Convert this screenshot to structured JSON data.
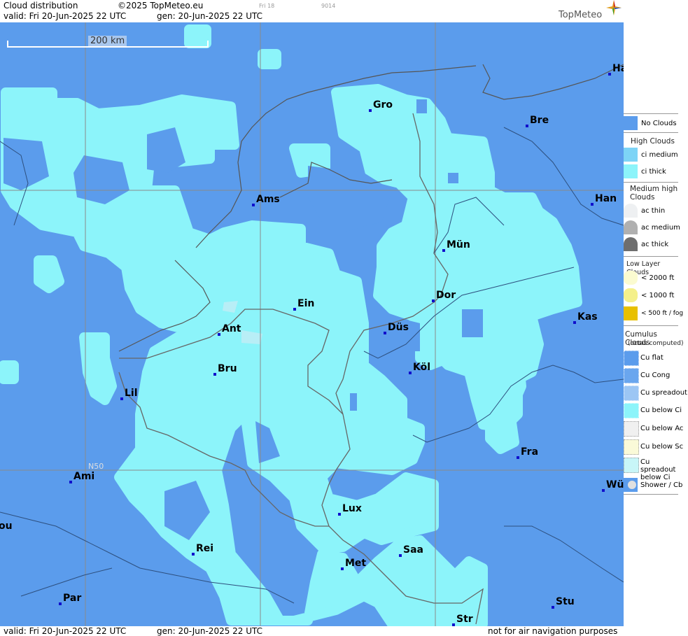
{
  "header": {
    "title": "Cloud distribution",
    "copyright": "©2025 TopMeteo.eu",
    "small1": "Fri 18",
    "small2": "9014",
    "valid": "valid:  Fri  20-Jun-2025  22 UTC",
    "gen": "gen: 20-Jun-2025 22 UTC",
    "brand": "TopMeteo"
  },
  "footer": {
    "valid": "valid:  Fri  20-Jun-2025  22 UTC",
    "gen": "gen: 20-Jun-2025 22 UTC",
    "disclaimer": "not for air navigation purposes"
  },
  "map": {
    "scale_label": "200 km",
    "lat_label": "N50",
    "colors": {
      "no_clouds": "#5b9cec",
      "ci_thick": "#8cf4fa",
      "ci_medium": "#7dd4f6",
      "grid": "#8a8a8a",
      "city_dot": "#1010cc"
    },
    "cities": [
      {
        "name": "Ha"
      },
      {
        "name": "Gro"
      },
      {
        "name": "Bre"
      },
      {
        "name": "Ams"
      },
      {
        "name": "Han"
      },
      {
        "name": "Mün"
      },
      {
        "name": "Dor"
      },
      {
        "name": "Ein"
      },
      {
        "name": "Ant"
      },
      {
        "name": "Düs"
      },
      {
        "name": "Kas"
      },
      {
        "name": "Bru"
      },
      {
        "name": "Köl"
      },
      {
        "name": "Lil"
      },
      {
        "name": "Fra"
      },
      {
        "name": "Ami"
      },
      {
        "name": "Wü"
      },
      {
        "name": "Lux"
      },
      {
        "name": "ou"
      },
      {
        "name": "Rei"
      },
      {
        "name": "Saa"
      },
      {
        "name": "Met"
      },
      {
        "name": "Par"
      },
      {
        "name": "Stu"
      },
      {
        "name": "Str"
      }
    ]
  },
  "legend": {
    "no_clouds": "No Clouds",
    "high_clouds": "High Clouds",
    "ci_medium": "ci medium",
    "ci_thick": "ci thick",
    "medium_high": "Medium high Clouds",
    "ac_thin": "ac thin",
    "ac_medium": "ac medium",
    "ac_thick": "ac thick",
    "low_layer": "Low Layer Clouds",
    "lt2000": "< 2000 ft",
    "lt1000": "< 1000 ft",
    "lt500": "< 500 ft / fog",
    "cumulus": "Cumulus Clouds",
    "octas": "(octas computed)",
    "cu_flat": "Cu flat",
    "cu_cong": "Cu Cong",
    "cu_spreadout": "Cu spreadout",
    "cu_below_ci": "Cu below Ci",
    "cu_below_ac": "Cu below Ac",
    "cu_below_sc": "Cu below Sc",
    "cu_spreadout_below_ci": "Cu spreadout below Ci",
    "shower": "Shower / Cb"
  }
}
